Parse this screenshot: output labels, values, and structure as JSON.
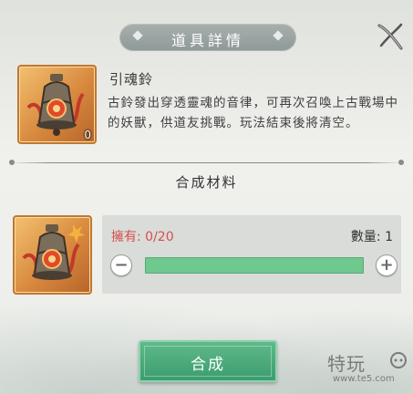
{
  "dialog": {
    "title": "道具詳情"
  },
  "item": {
    "name": "引魂鈴",
    "count": "0",
    "description": "古鈴發出穿透靈魂的音律，可再次召喚上古戰場中的妖獸，供道友挑戰。玩法結束後將清空。",
    "icon": "bell-icon"
  },
  "materials": {
    "section_title": "合成材料",
    "owned_label": "擁有: 0/20",
    "quantity_label": "數量: 1",
    "minus_label": "−",
    "plus_label": "+",
    "quantity_fill": 1.0,
    "icon": "bell-fragment-icon"
  },
  "actions": {
    "compose_label": "合成"
  },
  "watermark": {
    "main": "特玩",
    "sub": "www.te5.com"
  },
  "colors": {
    "owned_text": "#d74f4b",
    "compose_button": "#3b9d6e",
    "slider_fill": "#6fc98e",
    "icon_frame": "#d8893e"
  }
}
